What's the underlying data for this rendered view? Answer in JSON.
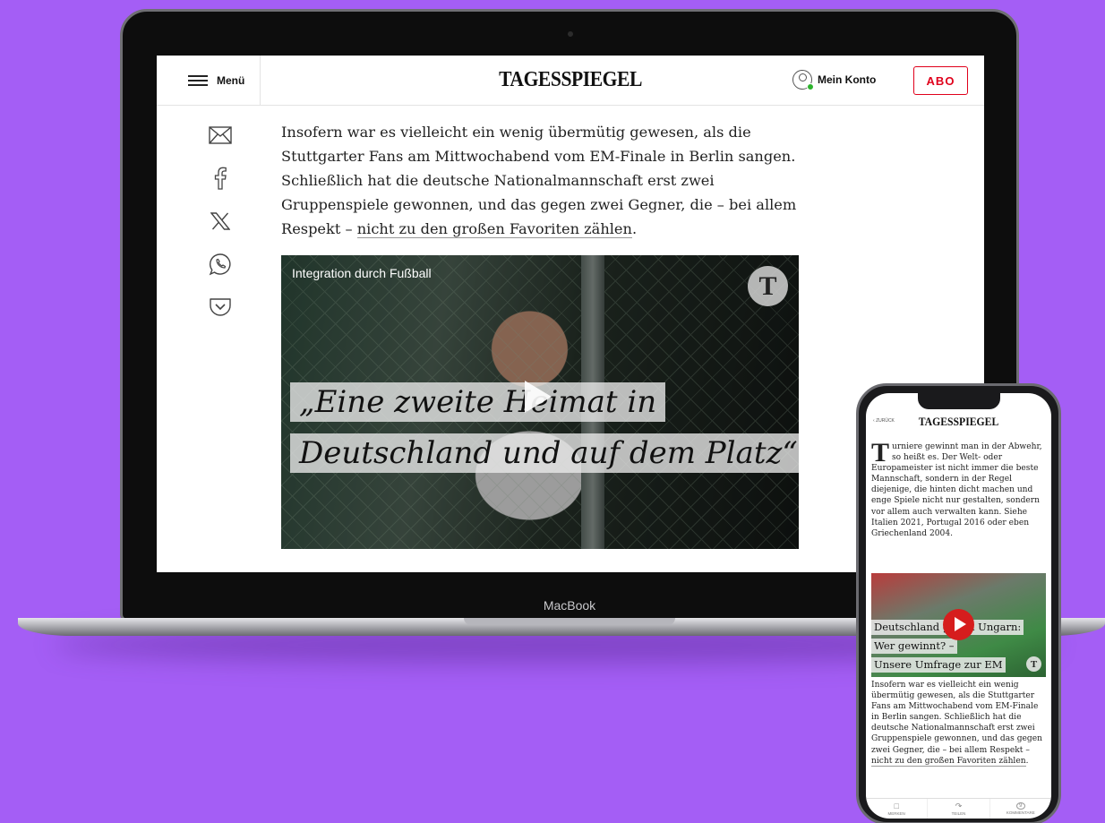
{
  "laptop": {
    "brand_label": "MacBook",
    "header": {
      "menu_label": "Menü",
      "logo": "TAGESSPIEGEL",
      "account_label": "Mein Konto",
      "subscribe_label": "ABO"
    },
    "share_icons": [
      "mail-icon",
      "facebook-icon",
      "x-icon",
      "whatsapp-icon",
      "pocket-icon"
    ],
    "article": {
      "paragraph": "Insofern war es vielleicht ein wenig übermütig gewesen, als die Stuttgarter Fans am Mittwochabend vom EM-Finale in Berlin sangen. Schließlich hat die deutsche Nationalmannschaft erst zwei Gruppenspiele gewonnen, und das gegen zwei Gegner, die – bei allem Respekt –",
      "link_text": "nicht zu den großen Favoriten zählen",
      "trailing": "."
    },
    "video": {
      "kicker": "Integration durch Fußball",
      "badge": "T",
      "headline_line1": "„Eine zweite Heimat in",
      "headline_line2": "Deutschland und auf dem Platz“"
    }
  },
  "phone": {
    "back_label": "ZURÜCK",
    "logo": "TAGESSPIEGEL",
    "intro_dropcap": "T",
    "intro_text": "urniere gewinnt man in der Abwehr, so heißt es. Der Welt- oder Europameister ist nicht immer die beste Mannschaft, sondern in der Regel diejenige, die hinten dicht machen und enge Spiele nicht nur gestalten, sondern vor allem auch verwalten kann. Siehe Italien 2021, Portugal 2016 oder eben Griechenland 2004.",
    "video": {
      "line1": "Deutschland gegen Ungarn:",
      "line2": "Wer gewinnt? –",
      "line3": "Unsere Umfrage zur EM",
      "badge": "T"
    },
    "body_text": "Insofern war es vielleicht ein wenig übermütig gewesen, als die Stuttgarter Fans am Mittwochabend vom EM-Finale in Berlin sangen. Schließlich hat die deutsche Nationalmannschaft erst zwei Gruppenspiele gewonnen, und das gegen zwei Gegner, die – bei allem Respekt –",
    "body_link": "nicht zu den großen Favoriten zählen",
    "body_trailing": ".",
    "bottom_bar": [
      {
        "label": "MERKEN",
        "icon": "bookmark-icon"
      },
      {
        "label": "TEILEN",
        "icon": "share-icon"
      },
      {
        "label": "KOMMENTARE",
        "icon": "comment-icon",
        "count": "9"
      }
    ]
  },
  "colors": {
    "background": "#a45ef5",
    "accent_red": "#e0001b",
    "online_dot": "#2db32d"
  }
}
